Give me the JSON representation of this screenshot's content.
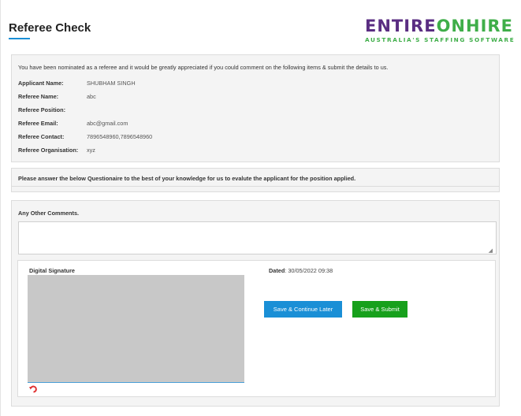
{
  "page": {
    "title": "Referee Check"
  },
  "logo": {
    "part1": "ENTIRE",
    "part2": "ONHIRE",
    "tagline": "AUSTRALIA'S STAFFING SOFTWARE"
  },
  "info": {
    "intro": "You have been nominated as a referee and it would be greatly appreciated if you could comment on the following items & submit the details to us.",
    "fields": [
      {
        "label": "Applicant Name:",
        "value": "SHUBHAM SINGH"
      },
      {
        "label": "Referee Name:",
        "value": "abc"
      },
      {
        "label": "Referee Position:",
        "value": ""
      },
      {
        "label": "Referee Email:",
        "value": "abc@gmail.com"
      },
      {
        "label": "Referee Contact:",
        "value": "7896548960,7896548960"
      },
      {
        "label": "Referee Organisation:",
        "value": "xyz"
      }
    ]
  },
  "questionnaire": {
    "text": "Please answer the below Questionaire to the best of your knowledge for us to evalute the applicant for the position applied."
  },
  "comments": {
    "label": "Any Other Comments.",
    "value": ""
  },
  "signature": {
    "label": "Digital Signature",
    "dated_label": "Dated",
    "dated_value": ": 30/05/2022 09:38",
    "undo_icon": "undo-arrow-icon",
    "canvas_color": "#c8c8c8"
  },
  "buttons": {
    "save_later": "Save & Continue Later",
    "save_submit": "Save & Submit"
  },
  "colors": {
    "primary_blue": "#1a8fd6",
    "submit_green": "#17a01c",
    "brand_purple": "#5a2d82",
    "brand_green": "#3fae49"
  }
}
